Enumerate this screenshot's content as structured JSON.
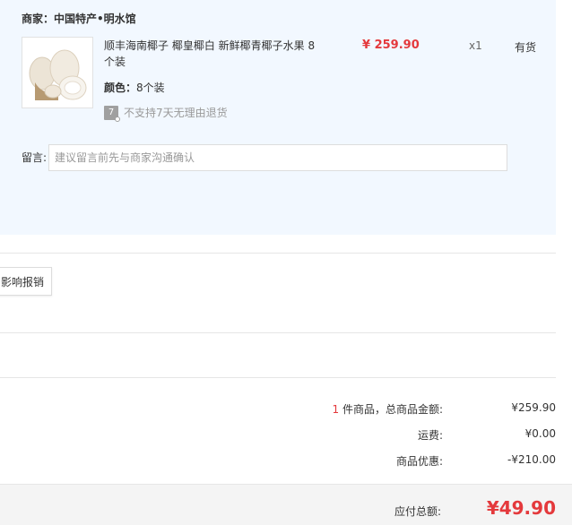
{
  "store": {
    "label": "商家：",
    "name": "中国特产•明水馆"
  },
  "product": {
    "image_icon": "coconut-product-image",
    "title": "顺丰海南椰子 椰皇椰白 新鲜椰青椰子水果 8个装",
    "price": "¥ 259.90",
    "quantity": "x1",
    "stock": "有货",
    "color_label": "颜色：",
    "color_value": "8个装",
    "return_icon_text": "7",
    "return_policy": "不支持7天无理由退货"
  },
  "remark": {
    "label": "留言:",
    "placeholder": "建议留言前先与商家沟通确认"
  },
  "invoice": {
    "button_label": "影响报销"
  },
  "summary": {
    "count": "1",
    "count_suffix": " 件商品，总商品金额:",
    "goods_total": "¥259.90",
    "shipping_label": "运费:",
    "shipping_value": "¥0.00",
    "discount_label": "商品优惠:",
    "discount_value": "-¥210.00"
  },
  "total": {
    "label": "应付总额:",
    "value": "¥49.90"
  },
  "colors": {
    "accent_red": "#e4393c",
    "panel_bg": "#f2f8ff",
    "total_bar_bg": "#f4f4f4"
  }
}
